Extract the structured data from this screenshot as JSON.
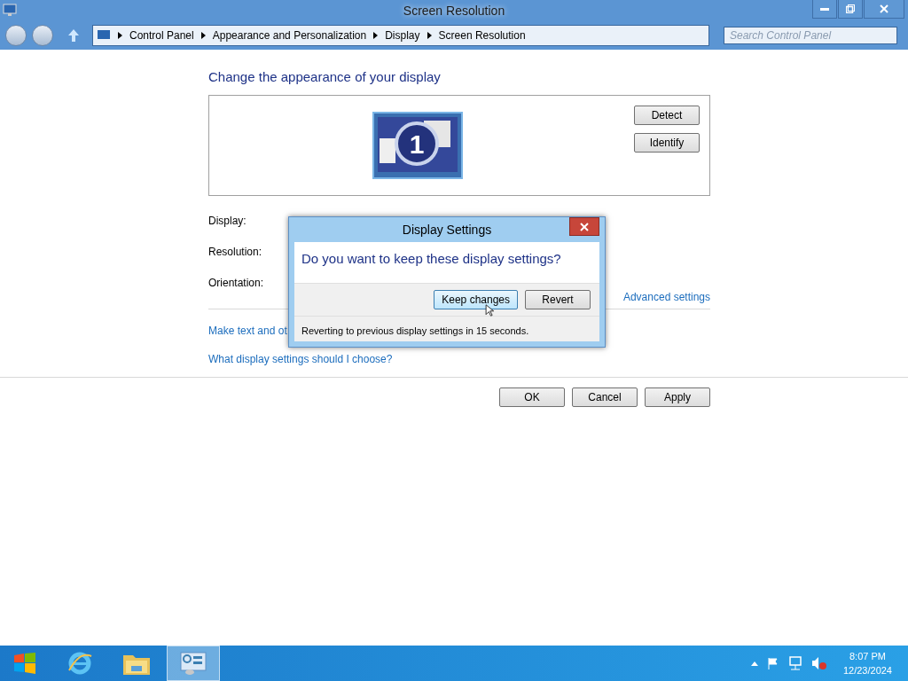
{
  "window": {
    "title": "Screen Resolution"
  },
  "breadcrumbs": [
    "Control Panel",
    "Appearance and Personalization",
    "Display",
    "Screen Resolution"
  ],
  "search": {
    "placeholder": "Search Control Panel"
  },
  "heading": "Change the appearance of your display",
  "monitor": {
    "number": "1"
  },
  "monitor_buttons": [
    "Detect",
    "Identify"
  ],
  "fields": [
    "Display:",
    "Resolution:",
    "Orientation:"
  ],
  "advanced_link": "Advanced settings",
  "links": [
    "Make text and ot",
    "What display settings should I choose?"
  ],
  "buttons": [
    "OK",
    "Cancel",
    "Apply"
  ],
  "dialog": {
    "title": "Display Settings",
    "question": "Do you want to keep these display settings?",
    "buttons": [
      {
        "label": "Keep changes",
        "selected": true
      },
      {
        "label": "Revert",
        "selected": false
      }
    ],
    "countdown": "Reverting to previous display settings in 15 seconds."
  },
  "taskbar": {
    "apps": [
      {
        "kind": "ie",
        "selected": false
      },
      {
        "kind": "folder",
        "selected": false
      },
      {
        "kind": "control",
        "selected": true
      }
    ],
    "time": "8:07 PM",
    "date": "12/23/2024"
  }
}
